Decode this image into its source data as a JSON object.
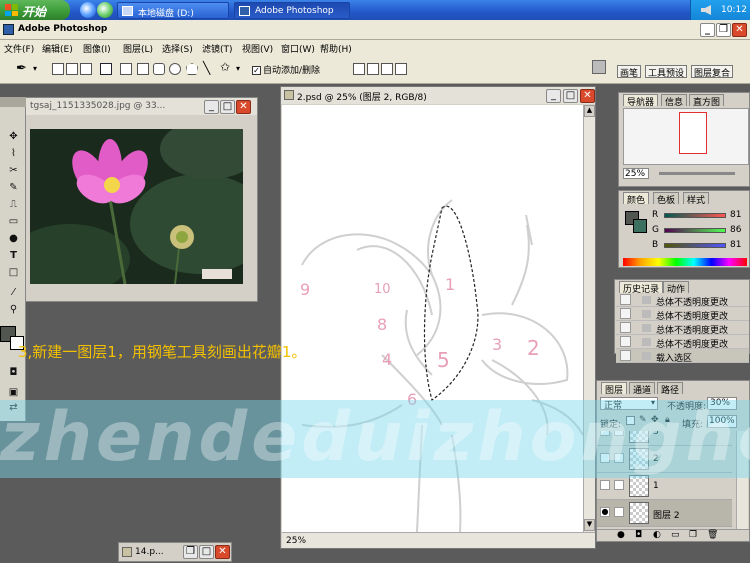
{
  "taskbar": {
    "start_label": "开始",
    "tasks": [
      {
        "label": "本地磁盘 (D:)"
      },
      {
        "label": "Adobe Photoshop"
      }
    ],
    "clock": "10:12"
  },
  "app": {
    "title": "Adobe Photoshop",
    "menu": [
      "文件(F)",
      "编辑(E)",
      "图像(I)",
      "图层(L)",
      "选择(S)",
      "滤镜(T)",
      "视图(V)",
      "窗口(W)",
      "帮助(H)"
    ]
  },
  "options": {
    "auto_add_label": "自动添加/删除",
    "auto_add_checked": true,
    "right_tabs": [
      "画笔",
      "工具预设",
      "图层复合"
    ]
  },
  "image_window": {
    "title": "tgsaj_1151335028.jpg @ 33..."
  },
  "document": {
    "title": "2.psd @ 25% (图层 2, RGB/8)",
    "sketch_numbers": [
      "9",
      "10",
      "1",
      "8",
      "4",
      "5",
      "3",
      "2",
      "6"
    ]
  },
  "navigator": {
    "tabs": [
      "导航器",
      "信息",
      "直方图"
    ],
    "zoom": "25%"
  },
  "color": {
    "tabs": [
      "颜色",
      "色板",
      "样式"
    ],
    "channels": [
      {
        "name": "R",
        "value": "81"
      },
      {
        "name": "G",
        "value": "86"
      },
      {
        "name": "B",
        "value": "81"
      }
    ],
    "foreground": "#515651"
  },
  "history": {
    "tabs": [
      "历史记录",
      "动作"
    ],
    "items": [
      "总体不透明度更改",
      "总体不透明度更改",
      "总体不透明度更改",
      "总体不透明度更改",
      "载入选区"
    ]
  },
  "layers": {
    "tabs": [
      "图层",
      "通道",
      "路径"
    ],
    "blend_mode": "正常",
    "opacity_label": "不透明度:",
    "opacity_value": "30%",
    "lock_label": "锁定:",
    "fill_label": "填充:",
    "fill_value": "100%",
    "items": [
      {
        "name": "3"
      },
      {
        "name": "2"
      },
      {
        "name": "1"
      },
      {
        "name": "图层 2"
      }
    ]
  },
  "caption": "3,新建一图层1，用钢笔工具刻画出花瓣1。",
  "watermark": "zhendeduizhonghe",
  "minimized_window": {
    "title": "14.p..."
  }
}
